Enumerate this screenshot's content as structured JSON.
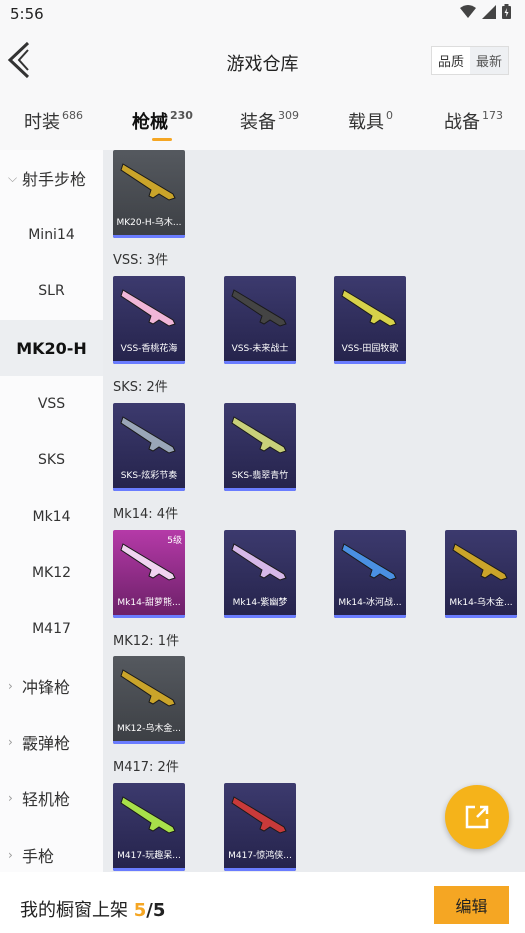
{
  "status_bar": {
    "time": "5:56"
  },
  "header": {
    "title": "游戏仓库",
    "sort_quality": "品质",
    "sort_latest": "最新"
  },
  "tabs": [
    {
      "label": "时装",
      "count": "686"
    },
    {
      "label": "枪械",
      "count": "230"
    },
    {
      "label": "装备",
      "count": "309"
    },
    {
      "label": "载具",
      "count": "0"
    },
    {
      "label": "战备",
      "count": "173"
    }
  ],
  "sidebar": {
    "items": [
      {
        "label": "射手步枪",
        "kind": "category-open"
      },
      {
        "label": "Mini14"
      },
      {
        "label": "SLR"
      },
      {
        "label": "MK20-H",
        "active": true
      },
      {
        "label": "VSS"
      },
      {
        "label": "SKS"
      },
      {
        "label": "Mk14"
      },
      {
        "label": "MK12"
      },
      {
        "label": "M417"
      },
      {
        "label": "冲锋枪",
        "kind": "category"
      },
      {
        "label": "霰弹枪",
        "kind": "category"
      },
      {
        "label": "轻机枪",
        "kind": "category"
      },
      {
        "label": "手枪",
        "kind": "category"
      }
    ]
  },
  "content": {
    "top_card": {
      "name": "MK20-H-乌木...",
      "style": "gray",
      "gun_color": "#caa42a"
    },
    "sections": [
      {
        "label": "VSS: 3件",
        "cards": [
          {
            "name": "VSS-香桃花海",
            "style": "purple",
            "gun_color": "#f0b6d8"
          },
          {
            "name": "VSS-未来战士",
            "style": "purple",
            "gun_color": "#444444"
          },
          {
            "name": "VSS-田园牧歌",
            "style": "purple",
            "gun_color": "#d7d24a"
          }
        ]
      },
      {
        "label": "SKS: 2件",
        "cards": [
          {
            "name": "SKS-炫彩节奏",
            "style": "purple",
            "gun_color": "#9aa6b8"
          },
          {
            "name": "SKS-翡翠青竹",
            "style": "purple",
            "gun_color": "#c8d07a"
          }
        ]
      },
      {
        "label": "Mk14: 4件",
        "cards": [
          {
            "name": "Mk14-甜萝熊...",
            "style": "pink",
            "gun_color": "#f0d4f0",
            "level": "5级"
          },
          {
            "name": "Mk14-紫幽梦",
            "style": "purple",
            "gun_color": "#d6b8e8"
          },
          {
            "name": "Mk14-冰河战...",
            "style": "purple",
            "gun_color": "#4a90e2"
          },
          {
            "name": "Mk14-乌木金...",
            "style": "purple",
            "gun_color": "#caa42a"
          }
        ]
      },
      {
        "label": "MK12: 1件",
        "cards": [
          {
            "name": "MK12-乌木金...",
            "style": "gray",
            "gun_color": "#caa42a"
          }
        ]
      },
      {
        "label": "M417: 2件",
        "cards": [
          {
            "name": "M417-玩趣呆...",
            "style": "purple",
            "gun_color": "#a8e04a"
          },
          {
            "name": "M417-惊鸿侠...",
            "style": "purple",
            "gun_color": "#c83a3a"
          }
        ]
      }
    ]
  },
  "bottom_bar": {
    "text": "我的橱窗上架",
    "count": "5",
    "total": "/5",
    "edit_label": "编辑"
  },
  "colors": {
    "accent": "#f5a623",
    "fab": "#f5b31a"
  }
}
